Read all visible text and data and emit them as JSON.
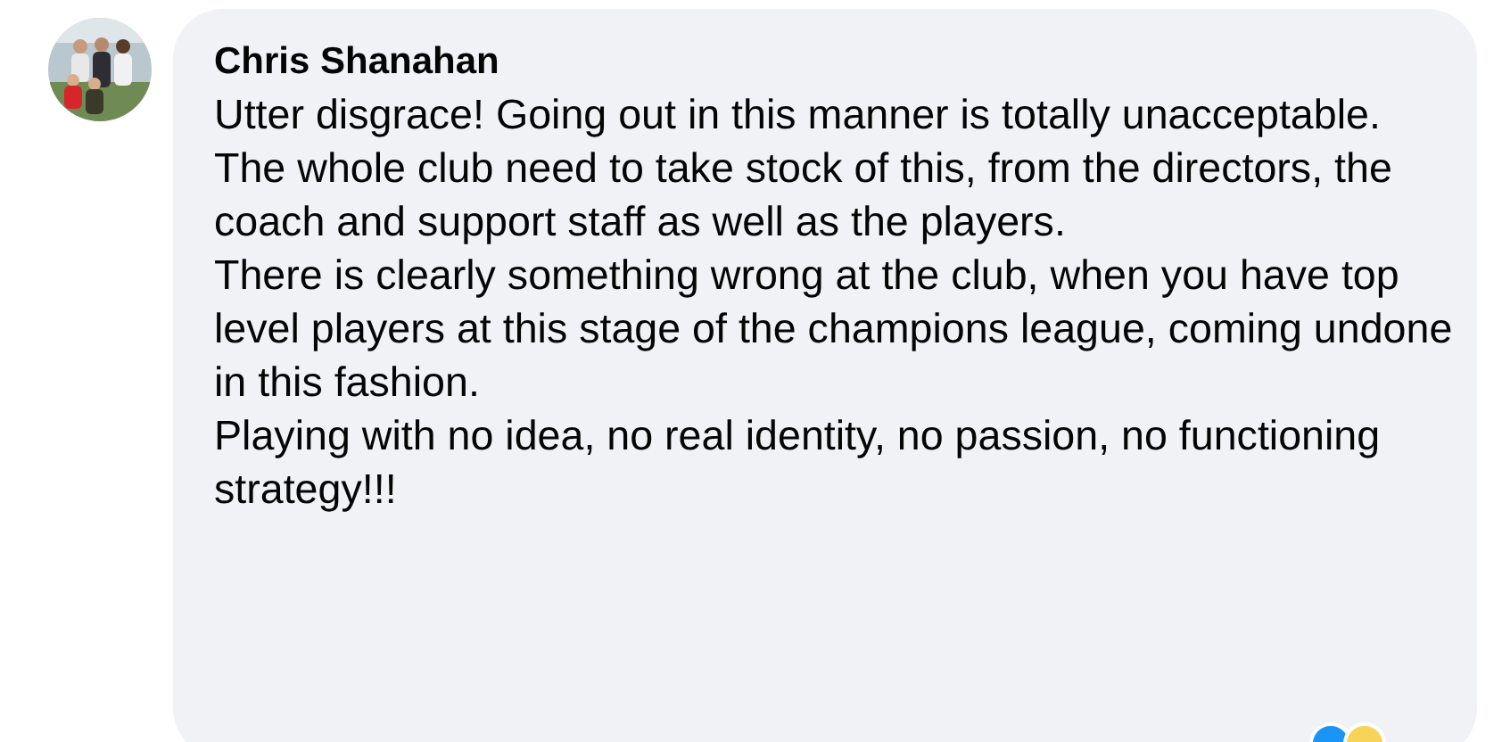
{
  "comment": {
    "author": "Chris Shanahan",
    "paragraphs": [
      "Utter disgrace! Going out in this manner is totally unacceptable.",
      "The whole club need to take stock of this, from the directors, the coach and support staff as well as the players.",
      "There is clearly something wrong at the club, when you have top level players at this stage of the champions league, coming undone in this fashion.",
      "Playing with no idea, no real identity, no passion, no functioning strategy!!!"
    ]
  }
}
